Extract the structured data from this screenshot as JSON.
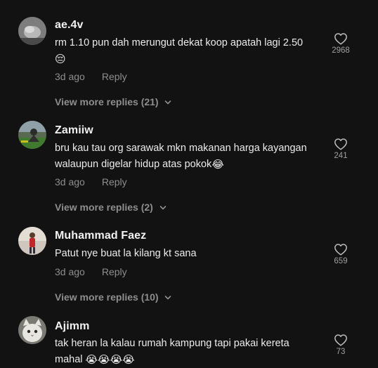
{
  "comments": [
    {
      "username": "ae.4v",
      "text": "rm 1.10 pun dah merungut dekat koop apatah lagi 2.50",
      "emojis": "😔",
      "time": "3d ago",
      "reply_label": "Reply",
      "view_replies": "View more replies (21)",
      "likes": "2968"
    },
    {
      "username": "Zamiiw",
      "text": "bru kau tau org sarawak mkn makanan harga kayangan walaupun digelar hidup atas pokok",
      "emojis": "😂",
      "time": "3d ago",
      "reply_label": "Reply",
      "view_replies": "View more replies (2)",
      "likes": "241"
    },
    {
      "username": "Muhammad Faez",
      "text": "Patut nye buat la kilang kt sana",
      "emojis": "",
      "time": "3d ago",
      "reply_label": "Reply",
      "view_replies": "View more replies (10)",
      "likes": "659"
    },
    {
      "username": "Ajimm",
      "text": "tak heran la kalau rumah kampung tapi pakai kereta mahal",
      "emojis": "😭😭😭😭",
      "time": "",
      "reply_label": "",
      "view_replies": "",
      "likes": "73"
    }
  ],
  "icons": {
    "like": "heart-outline-icon",
    "expand": "chevron-down-icon"
  },
  "colors": {
    "background": "#121212",
    "primary_text": "#ececec",
    "secondary_text": "#8e8e8e"
  }
}
